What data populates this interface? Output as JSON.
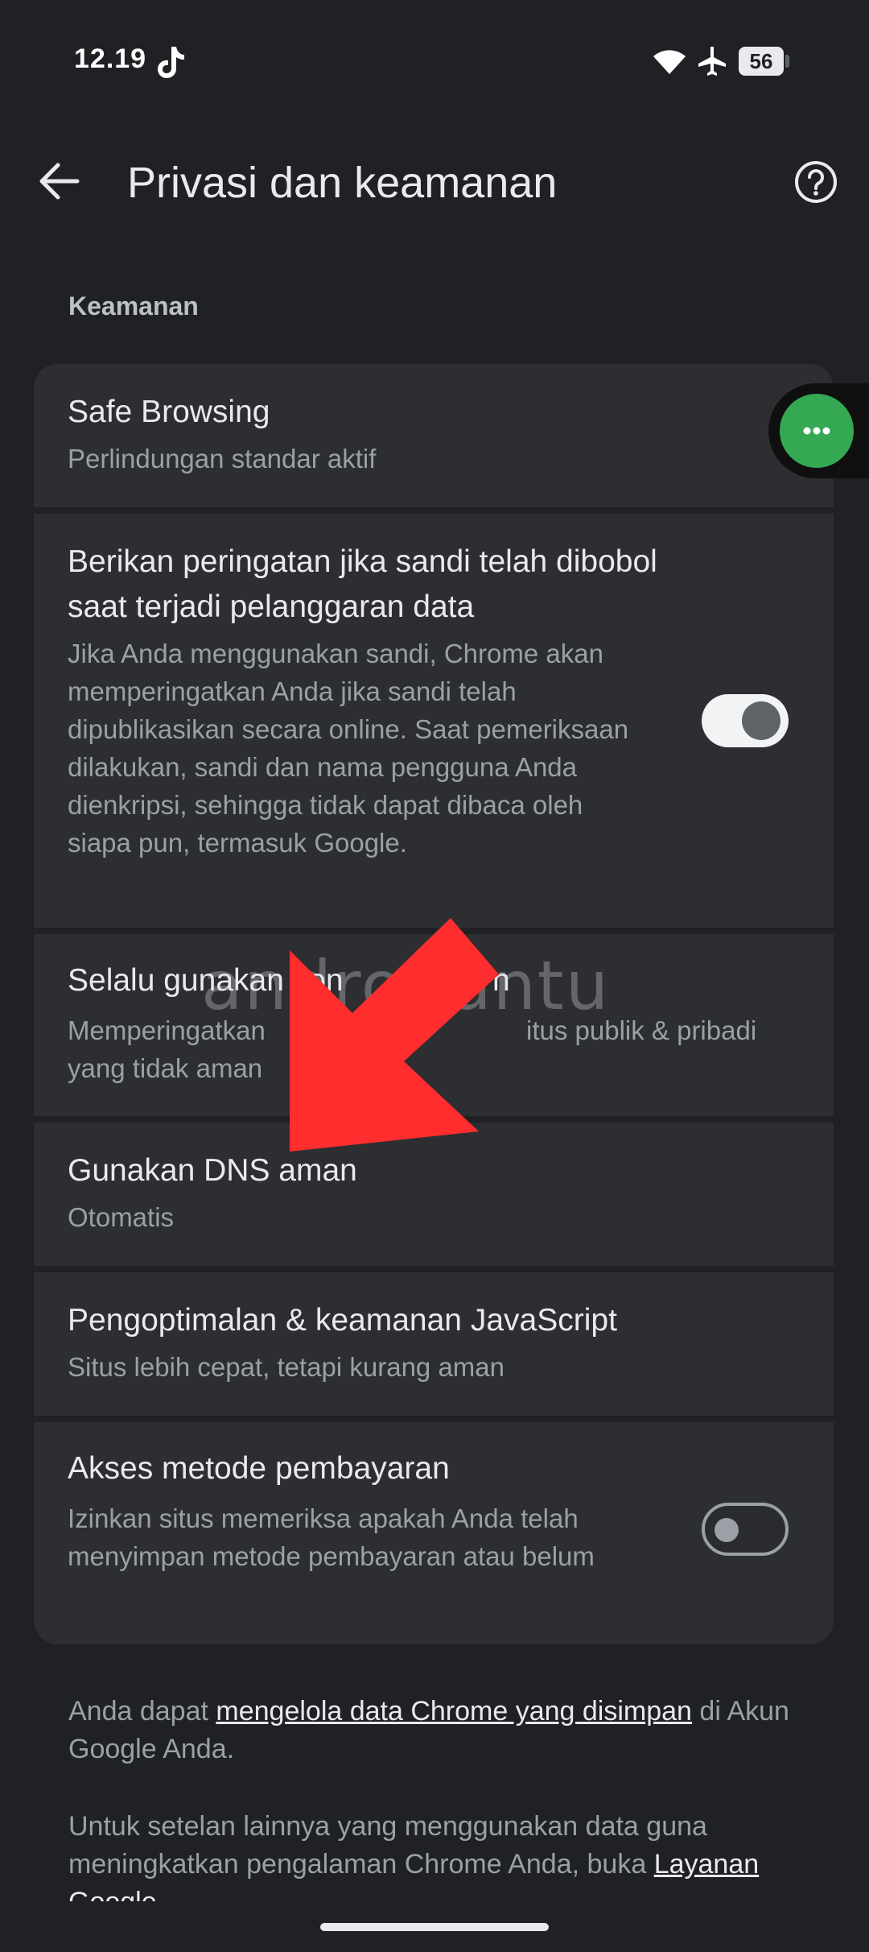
{
  "status_bar": {
    "time": "12.19",
    "battery": "56"
  },
  "header": {
    "title": "Privasi dan keamanan"
  },
  "section": {
    "title": "Keamanan"
  },
  "items": [
    {
      "title": "Safe Browsing",
      "subtitle": "Perlindungan standar aktif"
    },
    {
      "title": "Berikan peringatan jika sandi telah dibobol saat terjadi pelanggaran data",
      "subtitle": "Jika Anda menggunakan sandi, Chrome akan memperingatkan Anda jika sandi telah dipublikasikan secara online. Saat pemeriksaan dilakukan, sandi dan nama pengguna Anda dienkripsi, sehingga tidak dapat dibaca oleh siapa pun, termasuk Google.",
      "toggle": "on"
    },
    {
      "title": "Selalu gunakan kon",
      "title_end": "n",
      "subtitle_start": "Memperingatkan",
      "subtitle_end": "itus publik & pribadi",
      "subtitle_line2": "yang tidak aman"
    },
    {
      "title": "Gunakan DNS aman",
      "subtitle": "Otomatis"
    },
    {
      "title": "Pengoptimalan & keamanan JavaScript",
      "subtitle": "Situs lebih cepat, tetapi kurang aman"
    },
    {
      "title": "Akses metode pembayaran",
      "subtitle": "Izinkan situs memeriksa apakah Anda telah menyimpan metode pembayaran atau belum",
      "toggle": "off"
    }
  ],
  "footer": {
    "p1_before": "Anda dapat ",
    "p1_link": "mengelola data Chrome yang disimpan",
    "p1_after": " di Akun Google Anda.",
    "p2": "Untuk setelan lainnya yang menggunakan data guna meningkatkan pengalaman Chrome Anda, buka",
    "p2_cut": "Layanan Google"
  },
  "watermark": "androbuntu",
  "colors": {
    "background": "#202124",
    "card": "#2d2e31",
    "bubble": "#34a853",
    "arrow": "#ff2d2d"
  }
}
